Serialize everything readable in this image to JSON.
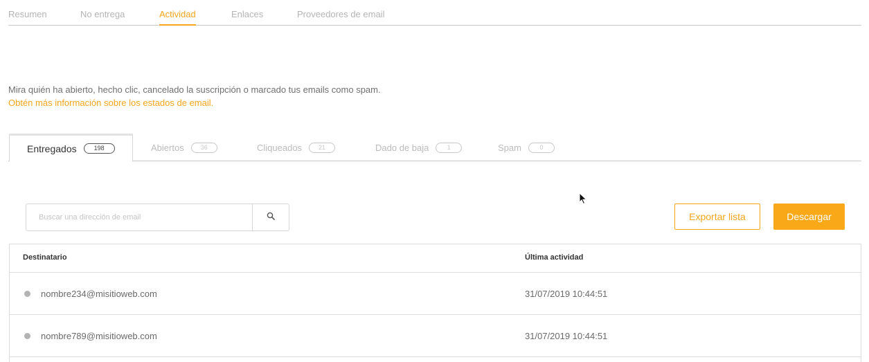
{
  "top_tabs": [
    {
      "label": "Resumen"
    },
    {
      "label": "No entrega"
    },
    {
      "label": "Actividad"
    },
    {
      "label": "Enlaces"
    },
    {
      "label": "Proveedores de email"
    }
  ],
  "active_top_tab": "Actividad",
  "intro": {
    "text": "Mira quién ha abierto, hecho clic, cancelado la suscripción o marcado tus emails como spam.",
    "link": "Obtén más información sobre los estados de email."
  },
  "status_tabs": [
    {
      "label": "Entregados",
      "count": "198"
    },
    {
      "label": "Abiertos",
      "count": "36"
    },
    {
      "label": "Cliqueados",
      "count": "21"
    },
    {
      "label": "Dado de baja",
      "count": "1"
    },
    {
      "label": "Spam",
      "count": "0"
    }
  ],
  "active_status_tab": "Entregados",
  "search": {
    "placeholder": "Buscar una dirección de email",
    "value": "",
    "icon": "search-icon"
  },
  "actions": {
    "export_label": "Exportar lista",
    "download_label": "Descargar"
  },
  "colors": {
    "accent": "#f4a51c",
    "download_bg": "#f9a818",
    "status_dot": "#b3b3b3"
  },
  "table": {
    "headers": {
      "recipient": "Destinatario",
      "last_activity": "Última actividad"
    },
    "rows": [
      {
        "email": "nombre234@misitioweb.com",
        "date": "31/07/2019 10:44:51"
      },
      {
        "email": "nombre789@misitioweb.com",
        "date": "31/07/2019 10:44:51"
      }
    ]
  }
}
